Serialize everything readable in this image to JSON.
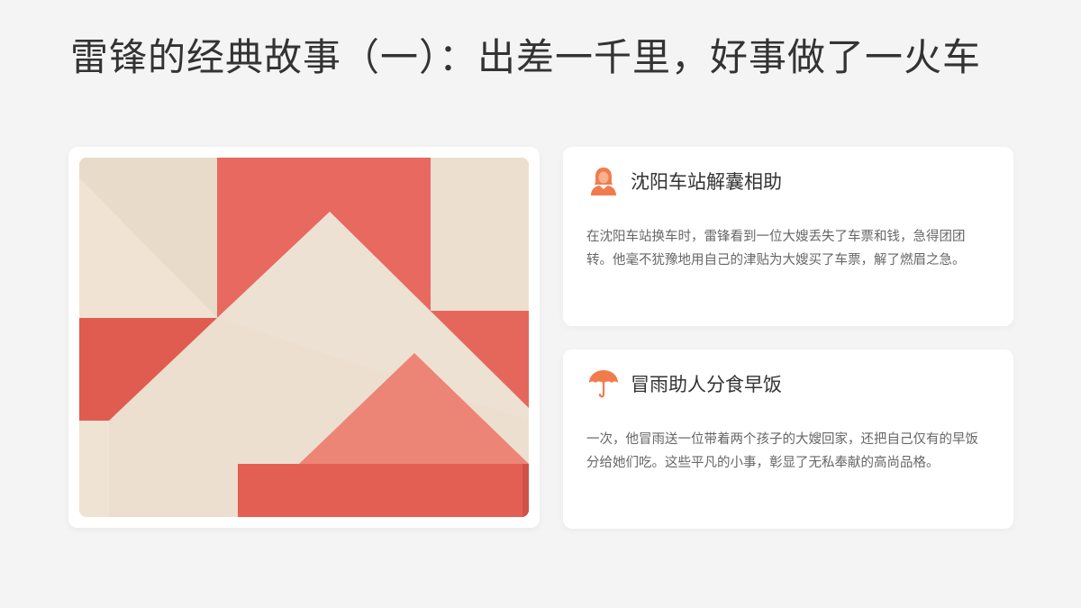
{
  "title": "雷锋的经典故事（一）：出差一千里，好事做了一火车",
  "colors": {
    "accent": "#f07c4d",
    "coral": "#e8695f",
    "beige": "#ecdfcf"
  },
  "cards": [
    {
      "icon": "woman-icon",
      "title": "沈阳车站解囊相助",
      "body": "在沈阳车站换车时，雷锋看到一位大嫂丢失了车票和钱，急得团团转。他毫不犹豫地用自己的津贴为大嫂买了车票，解了燃眉之急。"
    },
    {
      "icon": "umbrella-icon",
      "title": "冒雨助人分食早饭",
      "body": "一次，他冒雨送一位带着两个孩子的大嫂回家，还把自己仅有的早饭分给她们吃。这些平凡的小事，彰显了无私奉献的高尚品格。"
    }
  ]
}
